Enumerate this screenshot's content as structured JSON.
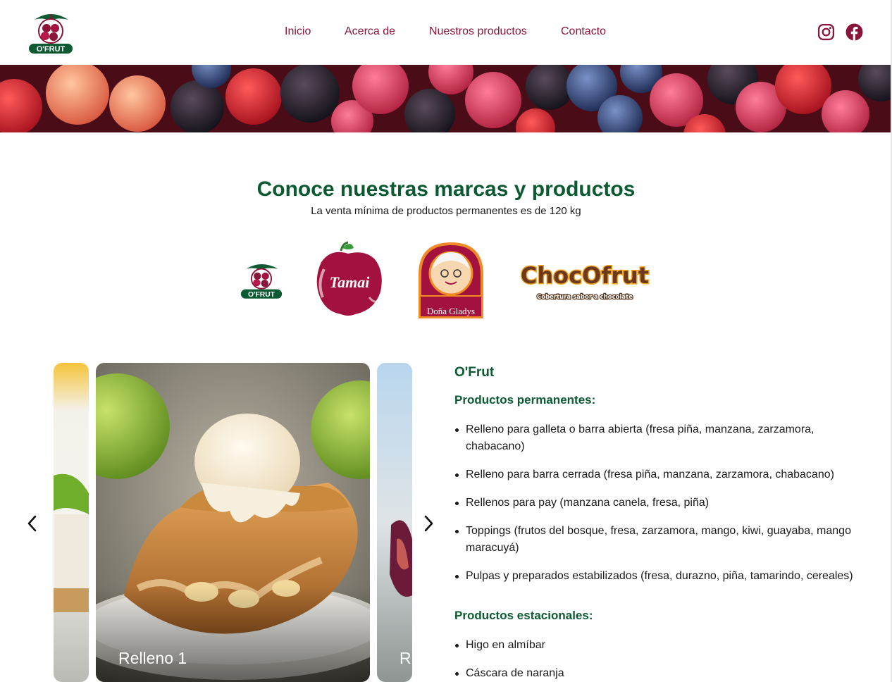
{
  "header": {
    "logo_text": "O'FRUT",
    "nav": [
      "Inicio",
      "Acerca de",
      "Nuestros productos",
      "Contacto"
    ],
    "social": [
      "instagram-icon",
      "facebook-icon"
    ]
  },
  "main": {
    "title": "Conoce nuestras marcas y productos",
    "subtitle": "La venta mínima de productos permanentes es de 120 kg",
    "brands": [
      {
        "name": "O'FRUT"
      },
      {
        "name": "Tamai"
      },
      {
        "name": "Doña Gladys"
      },
      {
        "name": "ChocOfrut",
        "tagline": "Cobertura sabor a chocolate"
      }
    ]
  },
  "carousel": {
    "slides": [
      {
        "label": "Relleno 1"
      },
      {
        "label": "R"
      }
    ]
  },
  "product": {
    "brand": "O'Frut",
    "permanent_title": "Productos permanentes:",
    "permanent": [
      "Relleno para galleta o barra abierta (fresa piña, manzana, zarzamora, chabacano)",
      "Relleno para barra cerrada (fresa piña, manzana, zarzamora, chabacano)",
      "Rellenos para pay (manzana canela, fresa, piña)",
      "Toppings (frutos del bosque, fresa, zarzamora, mango, kiwi, guayaba, mango maracuyá)",
      "Pulpas y preparados estabilizados (fresa, durazno, piña, tamarindo, cereales)"
    ],
    "seasonal_title": "Productos estacionales:",
    "seasonal": [
      "Higo en almíbar",
      "Cáscara de naranja"
    ]
  },
  "colors": {
    "primary_green": "#0c5a32",
    "accent_burgundy": "#8a1538"
  }
}
